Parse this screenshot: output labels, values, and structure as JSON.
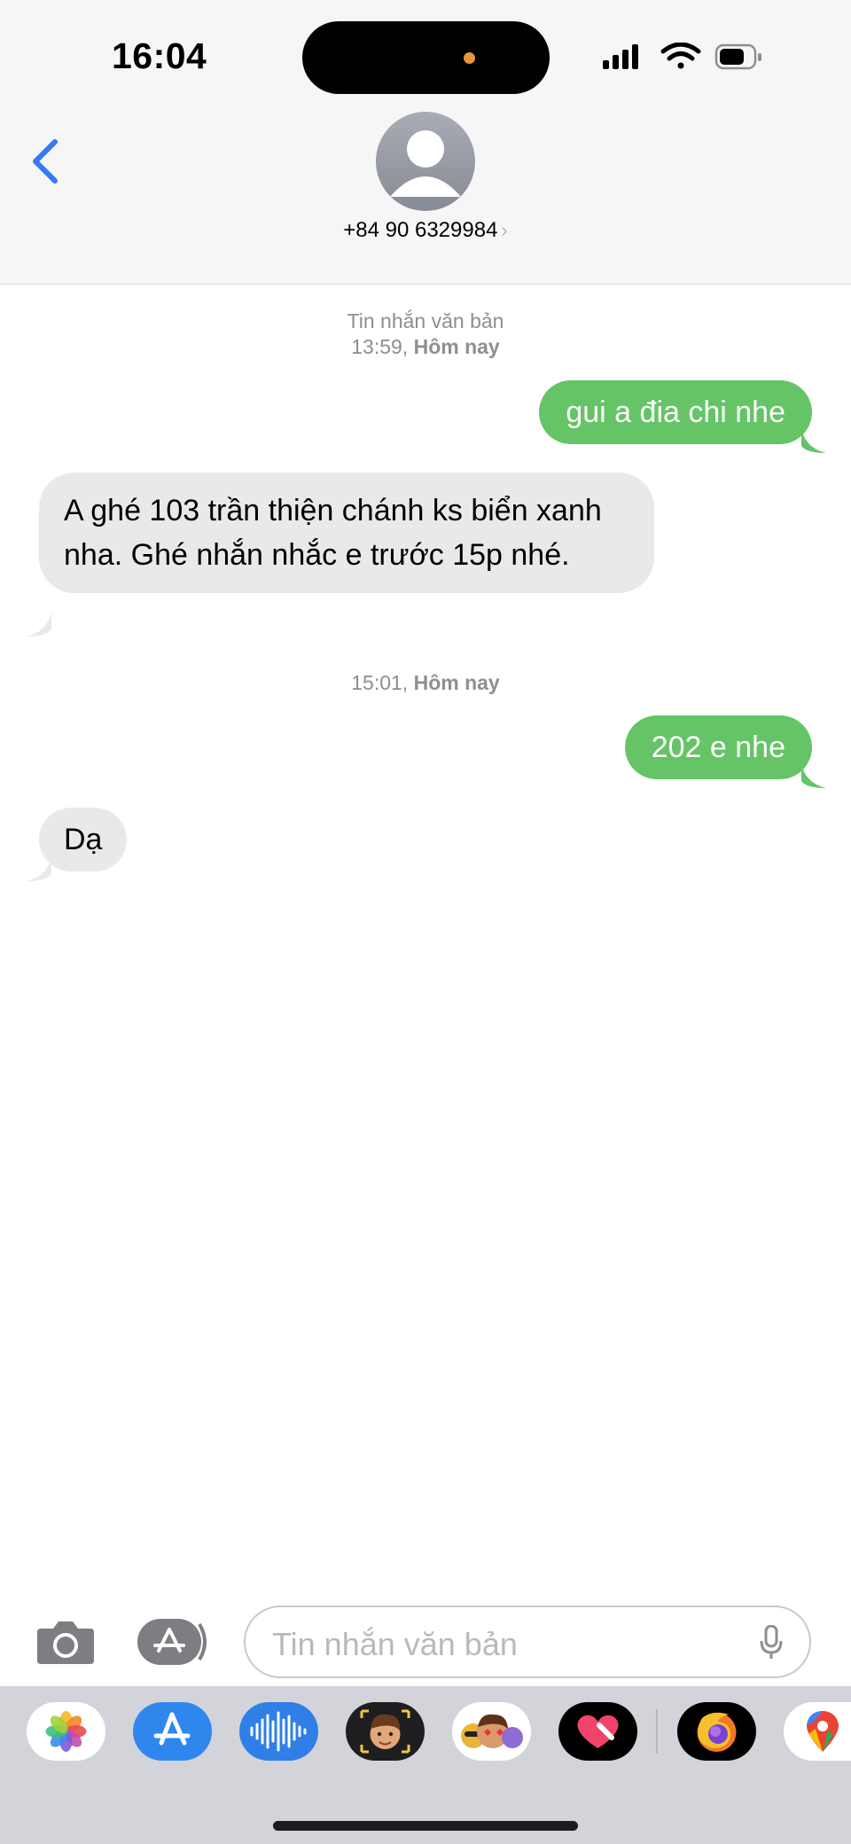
{
  "status_bar": {
    "time": "16:04"
  },
  "header": {
    "contact": "+84 90 6329984",
    "chevron": "›"
  },
  "colors": {
    "outgoing": "#65c466",
    "incoming": "#e9e9eb",
    "accent": "#3478f6"
  },
  "timestamps": {
    "first_label": "Tin nhắn văn bản",
    "first_time": "13:59,",
    "first_day": "Hôm nay",
    "second_time": "15:01,",
    "second_day": "Hôm nay"
  },
  "messages": [
    {
      "direction": "outgoing",
      "text": "gui a đia chi nhe"
    },
    {
      "direction": "incoming",
      "text": "A ghé 103 trần thiện chánh ks biển xanh nha. Ghé nhắn nhắc e trước 15p nhé."
    },
    {
      "direction": "outgoing",
      "text": "202 e nhe"
    },
    {
      "direction": "incoming",
      "text": "Dạ"
    }
  ],
  "composer": {
    "placeholder": "Tin nhắn văn bản"
  },
  "app_drawer": [
    "photos-icon",
    "app-store-icon",
    "audio-message-icon",
    "memoji-icon",
    "animoji-stickers-icon",
    "digital-touch-icon",
    "firefox-icon",
    "google-maps-icon"
  ]
}
